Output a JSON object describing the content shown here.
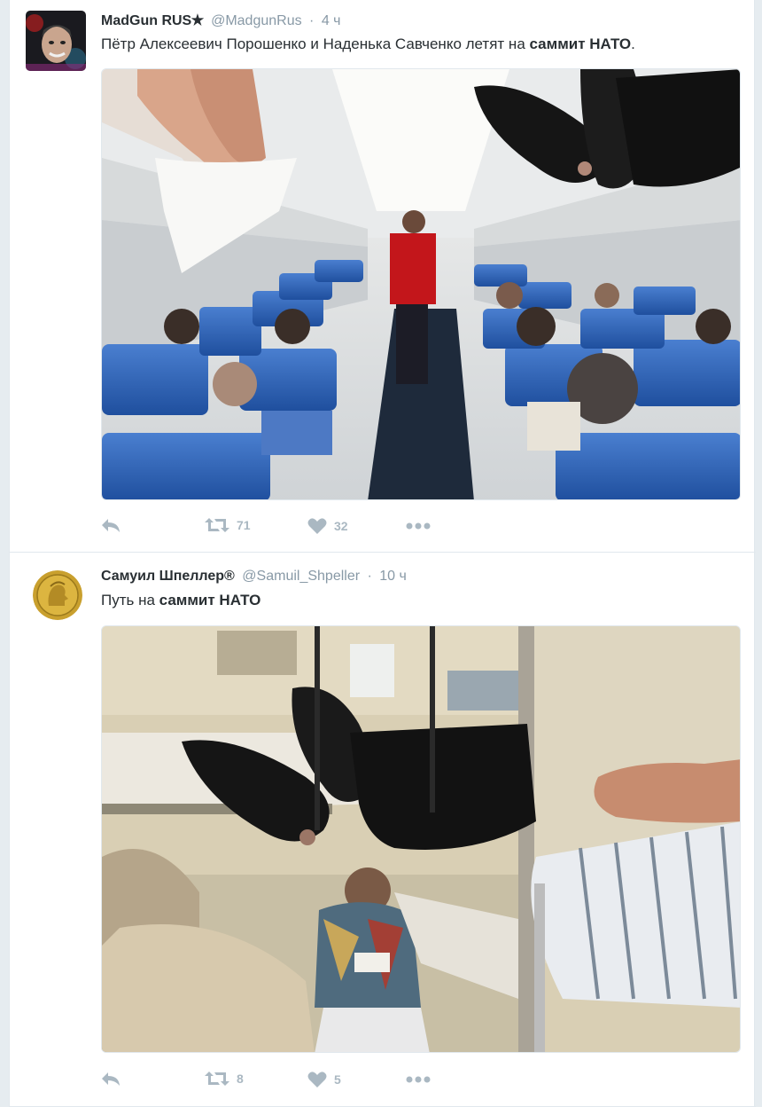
{
  "tweets": [
    {
      "fullname": "MadGun RUS✭",
      "username": "@MadgunRus",
      "separator": "·",
      "time": "4 ч",
      "text_plain": "Пётр Алексеевич Порошенко и Наденька Савченко летят на ",
      "text_bold": "саммит НАТО",
      "text_end": ".",
      "retweets": "71",
      "likes": "32"
    },
    {
      "fullname": "Самуил Шпеллер®",
      "username": "@Samuil_Shpeller",
      "separator": "·",
      "time": "10 ч",
      "text_plain": "Путь на ",
      "text_bold": "саммит НАТО",
      "text_end": "",
      "retweets": "8",
      "likes": "5"
    }
  ],
  "icons": {
    "reply": "reply-icon",
    "retweet": "retweet-icon",
    "like": "heart-icon",
    "more": "more-icon"
  },
  "colors": {
    "action_gray": "#aab8c2",
    "text": "#292f33",
    "meta": "#8899a6"
  }
}
